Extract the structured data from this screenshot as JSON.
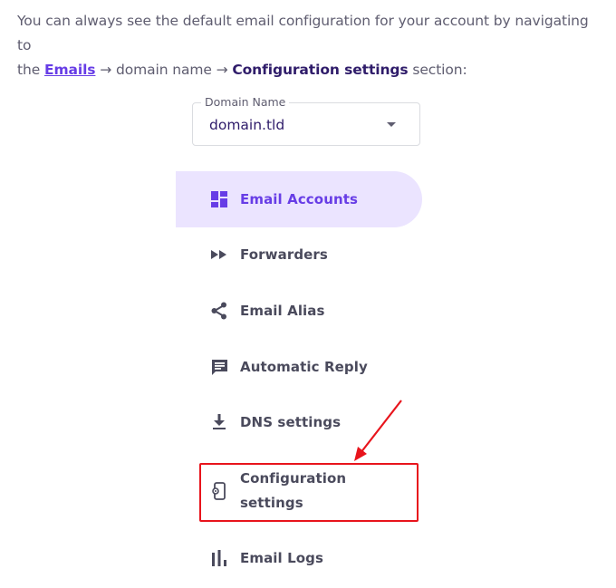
{
  "intro": {
    "line1": "You can always see the default email configuration for your account by navigating to",
    "the": "the",
    "link": "Emails",
    "middle": " → domain name → ",
    "bold": "Configuration settings",
    "end": " section:"
  },
  "domain_select": {
    "legend": "Domain Name",
    "value": "domain.tld"
  },
  "menu": {
    "items": [
      {
        "label": "Email Accounts",
        "icon": "dashboard-icon",
        "active": true
      },
      {
        "label": "Forwarders",
        "icon": "fast-forward-icon"
      },
      {
        "label": "Email Alias",
        "icon": "share-icon"
      },
      {
        "label": "Automatic Reply",
        "icon": "message-icon"
      },
      {
        "label": "DNS settings",
        "icon": "download-icon"
      },
      {
        "label": "Configuration settings",
        "icon": "device-settings-icon",
        "highlighted": true
      },
      {
        "label": "Email Logs",
        "icon": "bar-chart-icon"
      }
    ]
  },
  "colors": {
    "accent": "#673de6",
    "active_bg": "#ebe4ff",
    "highlight": "#e8141c",
    "text": "#4a4a5c"
  }
}
